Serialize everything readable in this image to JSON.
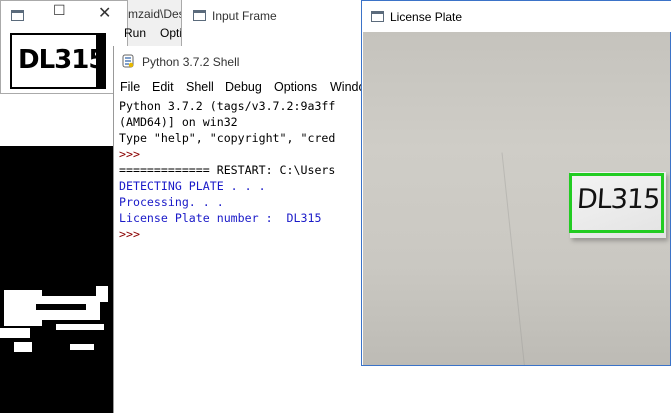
{
  "small_window": {
    "plate_text": "DL315"
  },
  "path_window": {
    "path_fragment": "mzaid\\Des",
    "menu_run": "Run",
    "menu_opt": "Opti"
  },
  "input_window": {
    "title": "Input Frame"
  },
  "shell": {
    "title": "Python 3.7.2 Shell",
    "menu": [
      "File",
      "Edit",
      "Shell",
      "Debug",
      "Options",
      "Windo"
    ],
    "lines": [
      {
        "text": "Python 3.7.2 (tags/v3.7.2:9a3ff",
        "color": "#000000"
      },
      {
        "text": "(AMD64)] on win32",
        "color": "#000000"
      },
      {
        "text": "Type \"help\", \"copyright\", \"cred",
        "color": "#000000"
      },
      {
        "text": ">>>",
        "color": "#8b0000"
      },
      {
        "text": "============= RESTART: C:\\Users",
        "color": "#000000"
      },
      {
        "text": "DETECTING PLATE . . .",
        "color": "#1a1ac8"
      },
      {
        "text": "Processing. . .",
        "color": "#1a1ac8"
      },
      {
        "text": "License Plate number :  DL315",
        "color": "#1a1ac8"
      },
      {
        "text": ">>>",
        "color": "#8b0000"
      }
    ]
  },
  "plate_window": {
    "title": "License Plate",
    "detected_text": "DL315",
    "box_color": "#22cc22"
  }
}
